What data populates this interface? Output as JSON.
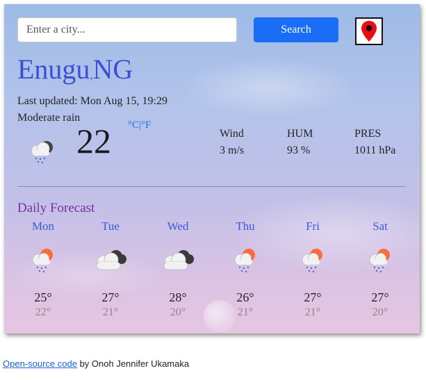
{
  "search": {
    "placeholder": "Enter a city...",
    "value": "",
    "button_label": "Search",
    "location_icon": "map-pin-icon"
  },
  "current": {
    "city": "Enugu",
    "separator": ",",
    "country": "NG",
    "last_updated": "Last updated: Mon Aug 15, 19:29",
    "condition": "Moderate rain",
    "condition_icon": "rain-cloud-icon",
    "temperature": "22",
    "unit_c": "°C",
    "unit_sep": "|",
    "unit_f": "°F",
    "stats": [
      {
        "label": "Wind",
        "value": "3 m/s"
      },
      {
        "label": "HUM",
        "value": "93 %"
      },
      {
        "label": "PRES",
        "value": "1011 hPa"
      }
    ]
  },
  "forecast": {
    "title": "Daily Forecast",
    "days": [
      {
        "day": "Mon",
        "icon": "sun-rain-cloud-icon",
        "high": "25°",
        "low": "22°"
      },
      {
        "day": "Tue",
        "icon": "dark-cloud-icon",
        "high": "27°",
        "low": "21°"
      },
      {
        "day": "Wed",
        "icon": "dark-cloud-icon",
        "high": "28°",
        "low": "20°"
      },
      {
        "day": "Thu",
        "icon": "sun-rain-cloud-icon",
        "high": "26°",
        "low": "21°"
      },
      {
        "day": "Fri",
        "icon": "sun-rain-cloud-icon",
        "high": "27°",
        "low": "21°"
      },
      {
        "day": "Sat",
        "icon": "sun-rain-cloud-icon",
        "high": "27°",
        "low": "20°"
      }
    ]
  },
  "footer": {
    "link_text": "Open-source code",
    "suffix": " by Onoh Jennifer Ukamaka"
  },
  "colors": {
    "accent": "#1a6ef5",
    "city": "#3b4ed6",
    "forecast_title": "#7a2e9b",
    "day_name": "#3b5bd6",
    "pin": "#e81010"
  }
}
